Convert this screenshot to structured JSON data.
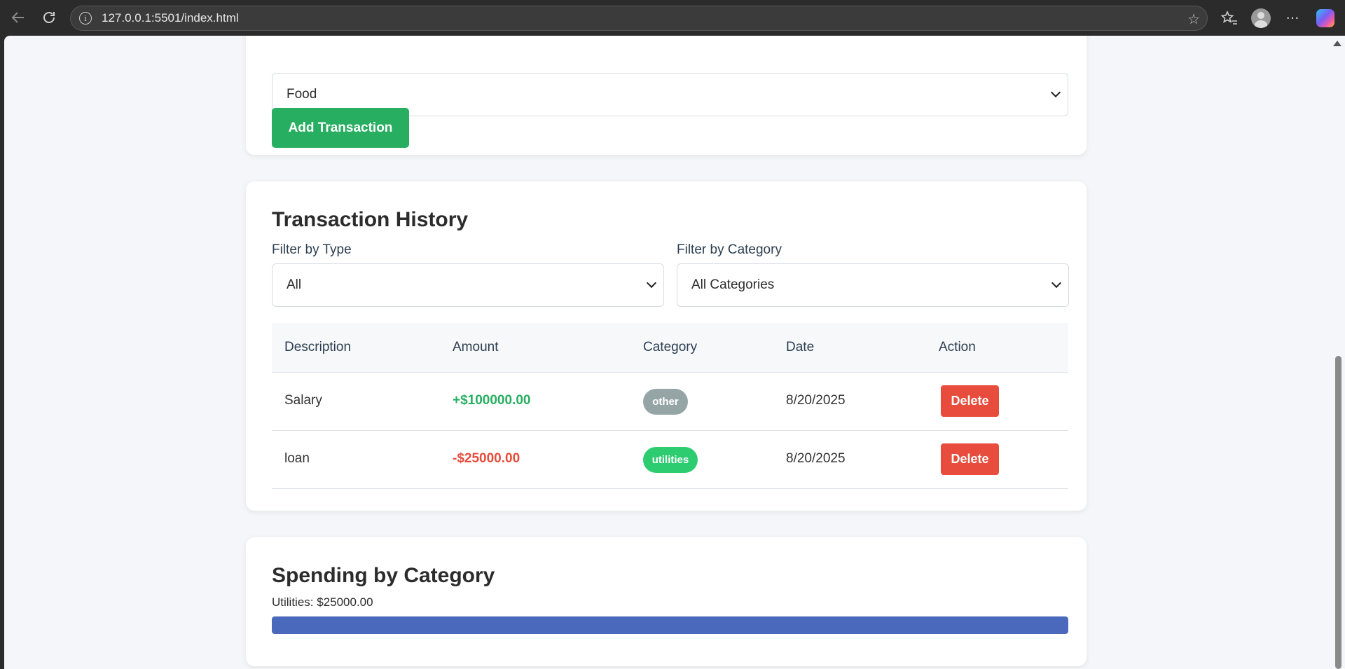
{
  "browser": {
    "url": "127.0.0.1:5501/index.html",
    "icons": [
      "back-icon",
      "refresh-icon",
      "info-icon",
      "star-icon",
      "favorites-icon",
      "profile-icon",
      "more-icon",
      "copilot-icon"
    ]
  },
  "form": {
    "category_value": "Food",
    "add_button": "Add Transaction"
  },
  "history": {
    "title": "Transaction History",
    "filter_type_label": "Filter by Type",
    "filter_type_value": "All",
    "filter_category_label": "Filter by Category",
    "filter_category_value": "All Categories",
    "columns": [
      "Description",
      "Amount",
      "Category",
      "Date",
      "Action"
    ],
    "rows": [
      {
        "description": "Salary",
        "amount": "+$100000.00",
        "amount_color": "#27ae60",
        "category": "other",
        "category_color": "#95a5a6",
        "date": "8/20/2025",
        "action": "Delete"
      },
      {
        "description": "loan",
        "amount": "-$25000.00",
        "amount_color": "#e74c3c",
        "category": "utilities",
        "category_color": "#2ecc71",
        "date": "8/20/2025",
        "action": "Delete"
      }
    ]
  },
  "spending": {
    "title": "Spending by Category",
    "items": [
      {
        "label": "Utilities: $25000.00",
        "fraction": 1.0,
        "color": "#4a69bd"
      }
    ]
  },
  "colors": {
    "accent_green": "#27ae60",
    "delete_red": "#e74c3c",
    "page_bg": "#f4f6f9"
  }
}
